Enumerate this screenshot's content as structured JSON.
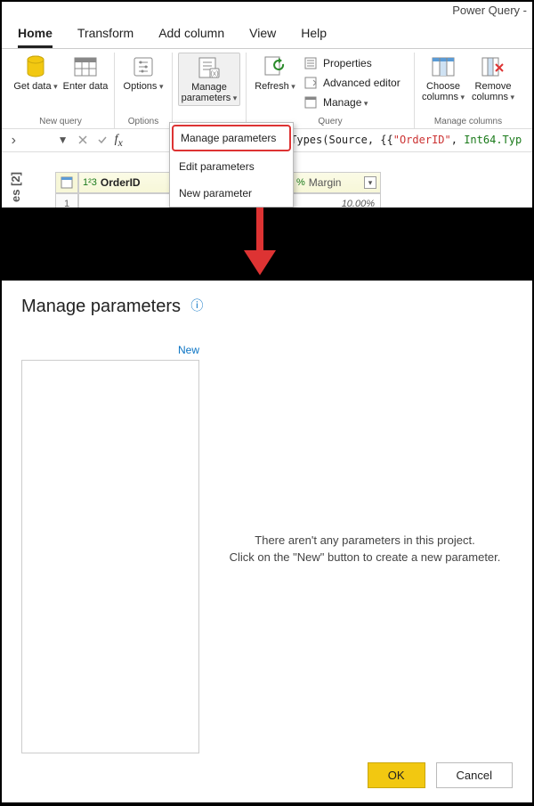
{
  "app_title": "Power Query -",
  "tabs": {
    "home": "Home",
    "transform": "Transform",
    "add_column": "Add column",
    "view": "View",
    "help": "Help"
  },
  "ribbon": {
    "get_data": "Get data",
    "enter_data": "Enter data",
    "options": "Options",
    "manage_parameters": "Manage parameters",
    "refresh": "Refresh",
    "properties": "Properties",
    "advanced_editor": "Advanced editor",
    "manage": "Manage",
    "choose_columns": "Choose columns",
    "remove_columns": "Remove columns",
    "group_new_query": "New query",
    "group_options": "Options",
    "group_query": "Query",
    "group_manage_columns": "Manage columns"
  },
  "dropdown": {
    "manage_parameters": "Manage parameters",
    "edit_parameters": "Edit parameters",
    "new_parameter": "New parameter"
  },
  "queries_panel": {
    "label": "es [2]"
  },
  "formula": {
    "prefix": "mnTypes(Source, {{",
    "order_id": "\"OrderID\"",
    "int64": "Int64.Typ"
  },
  "grid": {
    "type_prefix": "1²3",
    "col1": "OrderID",
    "pct_icon": "%",
    "col2": "Margin",
    "row1_idx": "1",
    "row1_val": "10.00%"
  },
  "dialog": {
    "title": "Manage parameters",
    "new": "New",
    "empty_line1": "There aren't any parameters in this project.",
    "empty_line2": "Click on the \"New\" button to create a new parameter.",
    "ok": "OK",
    "cancel": "Cancel"
  }
}
